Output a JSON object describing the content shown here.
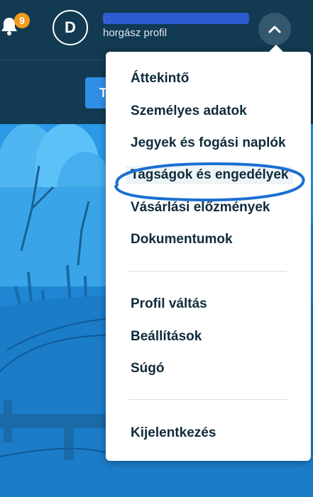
{
  "header": {
    "notification_count": "9",
    "avatar_initial": "D",
    "user_name": "D",
    "user_role": "horgász profil"
  },
  "subheader": {
    "button_label": "T"
  },
  "menu": {
    "items": [
      {
        "label": "Áttekintő"
      },
      {
        "label": "Személyes adatok"
      },
      {
        "label": "Jegyek és fogási naplók"
      },
      {
        "label": "Tagságok és engedélyek"
      },
      {
        "label": "Vásárlási előzmények"
      },
      {
        "label": "Dokumentumok"
      },
      {
        "label": "Profil váltás"
      },
      {
        "label": "Beállítások"
      },
      {
        "label": "Súgó"
      },
      {
        "label": "Kijelentkezés"
      }
    ]
  },
  "colors": {
    "header_bg": "#123a52",
    "badge": "#f39a1c",
    "accent": "#2f8fe6",
    "annotation": "#1b6fd1"
  }
}
